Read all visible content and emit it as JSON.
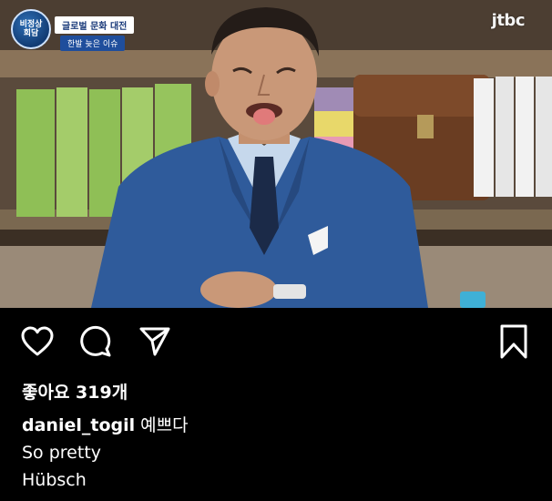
{
  "photo": {
    "show_badge_text": "비정상\n회담",
    "caption_top": "글로벌 문화 대전",
    "caption_sub": "한발 늦은 이슈",
    "network_logo": "jtbc"
  },
  "actions": {
    "like_icon": "heart-icon",
    "comment_icon": "comment-icon",
    "share_icon": "paper-plane-icon",
    "save_icon": "bookmark-icon"
  },
  "post": {
    "likes_text": "좋아요 319개",
    "username": "daniel_togil",
    "caption_first": "예쁘다",
    "caption_lines": "So pretty\nHübsch"
  }
}
